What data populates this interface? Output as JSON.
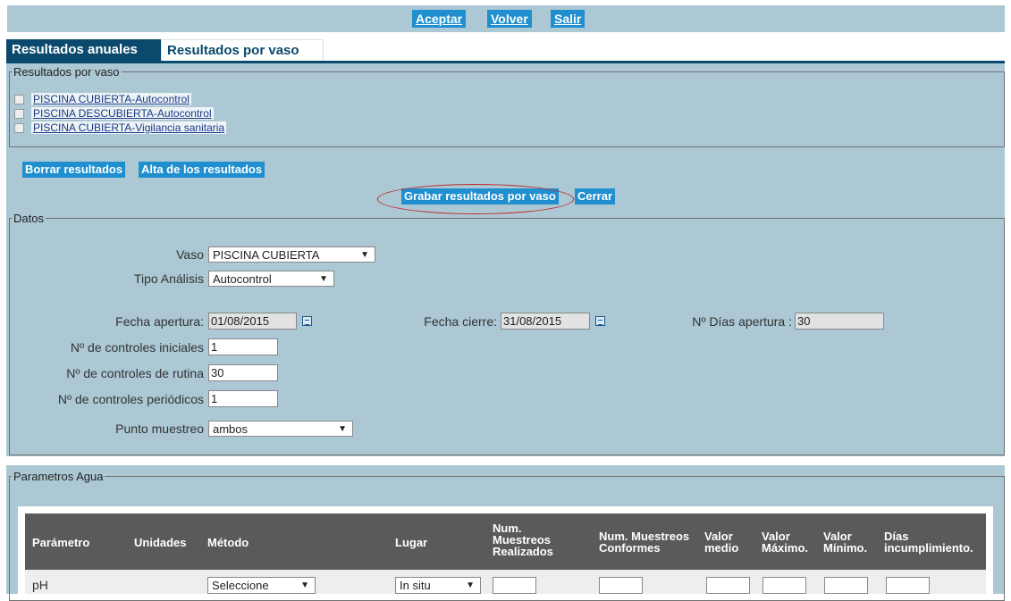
{
  "toolbar": {
    "accept": "Aceptar",
    "back": "Volver",
    "exit": "Salir"
  },
  "tabs": {
    "annual": "Resultados anuales",
    "by_vessel": "Resultados por vaso"
  },
  "vessel_results": {
    "legend": "Resultados por vaso",
    "items": [
      "PISCINA CUBIERTA-Autocontrol",
      "PISCINA DESCUBIERTA-Autocontrol",
      "PISCINA CUBIERTA-Vigilancia sanitaria"
    ]
  },
  "actions": {
    "delete_results": "Borrar resultados",
    "register_results": "Alta de los resultados",
    "save_by_vessel": "Grabar resultados por vaso",
    "close": "Cerrar"
  },
  "datos": {
    "legend": "Datos",
    "vaso_label": "Vaso",
    "vaso_value": "PISCINA CUBIERTA",
    "tipo_label": "Tipo Análisis",
    "tipo_value": "Autocontrol",
    "apertura_label": "Fecha apertura:",
    "apertura_value": "01/08/2015",
    "cierre_label": "Fecha cierre:",
    "cierre_value": "31/08/2015",
    "dias_label": "Nº Días apertura :",
    "dias_value": "30",
    "iniciales_label": "Nº de controles iniciales",
    "iniciales_value": "1",
    "rutina_label": "Nº de controles de rutina",
    "rutina_value": "30",
    "periodicos_label": "Nº de controles periódicos",
    "periodicos_value": "1",
    "punto_label": "Punto muestreo",
    "punto_value": "ambos"
  },
  "parametros": {
    "legend": "Parametros Agua",
    "headers": {
      "parametro": "Parámetro",
      "unidades": "Unidades",
      "metodo": "Método",
      "lugar": "Lugar",
      "realizados": [
        "Num.",
        "Muestreos",
        "Realizados"
      ],
      "conformes": [
        "Num. Muestreos",
        "Conformes"
      ],
      "medio": [
        "Valor",
        "medio"
      ],
      "maximo": [
        "Valor",
        "Máximo."
      ],
      "minimo": [
        "Valor",
        "Mínimo."
      ],
      "dias": [
        "Días",
        "incumplimiento."
      ]
    },
    "rows": [
      {
        "parametro": "pH",
        "metodo": "Seleccione",
        "lugar": "In situ"
      }
    ]
  }
}
